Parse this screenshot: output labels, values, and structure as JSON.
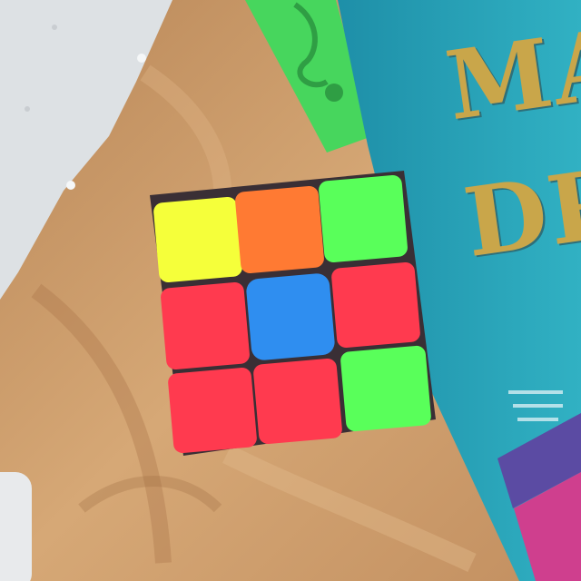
{
  "scene": {
    "description_objects": [
      "fabric-background",
      "paper-napkin",
      "green-clothespin",
      "blue-book",
      "rubiks-cube",
      "phone-edge"
    ],
    "book": {
      "title_line_1": "MA",
      "title_line_2": "DR"
    },
    "cube": {
      "grid": [
        [
          "#f5ff3a",
          "#ff7a33",
          "#59ff5a"
        ],
        [
          "#ff3a4f",
          "#2f8ef0",
          "#ff3a4f"
        ],
        [
          "#ff3a4f",
          "#ff3a4f",
          "#59ff5a"
        ]
      ]
    },
    "colors": {
      "fabric": "#c99a6c",
      "book": "#29a3b7",
      "book_title": "#c9a64a",
      "clothespin": "#47d65d",
      "napkin": "#dde1e4"
    }
  }
}
